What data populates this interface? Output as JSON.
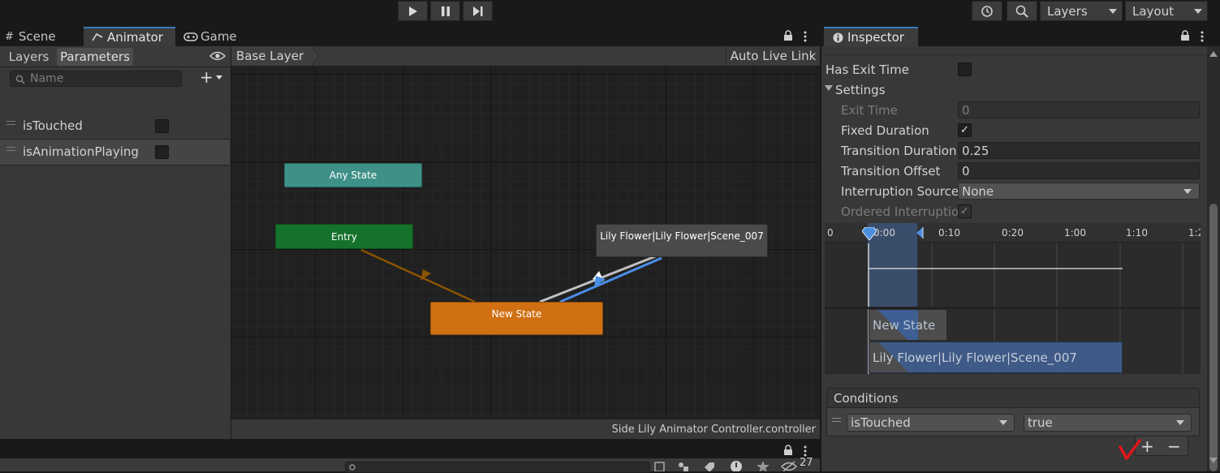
{
  "toolbar": {
    "play_icon": "play-icon",
    "pause_icon": "pause-icon",
    "step_icon": "step-icon",
    "history_icon": "history-icon",
    "search_icon": "search-icon",
    "layers": "Layers",
    "layout": "Layout"
  },
  "tabs": {
    "scene": "Scene",
    "animator": "Animator",
    "game": "Game"
  },
  "animator": {
    "layers_tab": "Layers",
    "parameters_tab": "Parameters",
    "search_placeholder": "Name",
    "add": "+",
    "breadcrumb": "Base Layer",
    "auto_live_link": "Auto Live Link",
    "parameters": [
      {
        "name": "isTouched",
        "value": false
      },
      {
        "name": "isAnimationPlaying",
        "value": false
      }
    ],
    "states": {
      "any": "Any State",
      "entry": "Entry",
      "new_state": "New State",
      "lily": "Lily Flower|Lily Flower|Scene_007"
    },
    "footer": "Side Lily Animator Controller.controller",
    "colors": {
      "any_state": "#3e9187",
      "entry": "#14722a",
      "default_state": "#d07013",
      "state": "#4a4a4a",
      "transition": "#bfbfbf",
      "selected_transition": "#4a8ee6"
    }
  },
  "inspector": {
    "tab": "Inspector",
    "has_exit_time": {
      "label": "Has Exit Time",
      "checked": false
    },
    "settings": "Settings",
    "exit_time": {
      "label": "Exit Time",
      "value": "0"
    },
    "fixed_duration": {
      "label": "Fixed Duration",
      "checked": true,
      "mark": "✓"
    },
    "transition_duration": {
      "label": "Transition Duration",
      "value": "0.25"
    },
    "transition_offset": {
      "label": "Transition Offset",
      "value": "0"
    },
    "interruption_source": {
      "label": "Interruption Source",
      "value": "None"
    },
    "ordered_interruption": {
      "label": "Ordered Interruption",
      "checked": true,
      "mark": "✓"
    },
    "timeline": {
      "ticks": [
        "0",
        "0:00",
        "0:10",
        "0:20",
        "1:00",
        "1:10",
        "1:2"
      ],
      "tracks": [
        "New State",
        "Lily Flower|Lily Flower|Scene_007"
      ]
    },
    "conditions": {
      "header": "Conditions",
      "parameter": "isTouched",
      "value": "true",
      "add": "+",
      "remove": "−"
    }
  },
  "bottom": {
    "count": "27"
  }
}
